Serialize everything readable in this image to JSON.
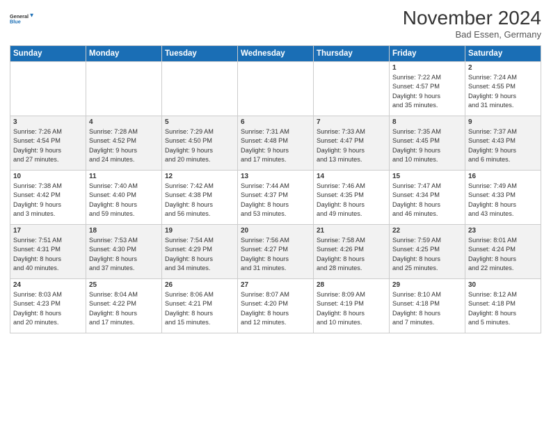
{
  "logo": {
    "line1": "General",
    "line2": "Blue"
  },
  "title": "November 2024",
  "location": "Bad Essen, Germany",
  "days_of_week": [
    "Sunday",
    "Monday",
    "Tuesday",
    "Wednesday",
    "Thursday",
    "Friday",
    "Saturday"
  ],
  "weeks": [
    [
      {
        "num": "",
        "info": ""
      },
      {
        "num": "",
        "info": ""
      },
      {
        "num": "",
        "info": ""
      },
      {
        "num": "",
        "info": ""
      },
      {
        "num": "",
        "info": ""
      },
      {
        "num": "1",
        "info": "Sunrise: 7:22 AM\nSunset: 4:57 PM\nDaylight: 9 hours\nand 35 minutes."
      },
      {
        "num": "2",
        "info": "Sunrise: 7:24 AM\nSunset: 4:55 PM\nDaylight: 9 hours\nand 31 minutes."
      }
    ],
    [
      {
        "num": "3",
        "info": "Sunrise: 7:26 AM\nSunset: 4:54 PM\nDaylight: 9 hours\nand 27 minutes."
      },
      {
        "num": "4",
        "info": "Sunrise: 7:28 AM\nSunset: 4:52 PM\nDaylight: 9 hours\nand 24 minutes."
      },
      {
        "num": "5",
        "info": "Sunrise: 7:29 AM\nSunset: 4:50 PM\nDaylight: 9 hours\nand 20 minutes."
      },
      {
        "num": "6",
        "info": "Sunrise: 7:31 AM\nSunset: 4:48 PM\nDaylight: 9 hours\nand 17 minutes."
      },
      {
        "num": "7",
        "info": "Sunrise: 7:33 AM\nSunset: 4:47 PM\nDaylight: 9 hours\nand 13 minutes."
      },
      {
        "num": "8",
        "info": "Sunrise: 7:35 AM\nSunset: 4:45 PM\nDaylight: 9 hours\nand 10 minutes."
      },
      {
        "num": "9",
        "info": "Sunrise: 7:37 AM\nSunset: 4:43 PM\nDaylight: 9 hours\nand 6 minutes."
      }
    ],
    [
      {
        "num": "10",
        "info": "Sunrise: 7:38 AM\nSunset: 4:42 PM\nDaylight: 9 hours\nand 3 minutes."
      },
      {
        "num": "11",
        "info": "Sunrise: 7:40 AM\nSunset: 4:40 PM\nDaylight: 8 hours\nand 59 minutes."
      },
      {
        "num": "12",
        "info": "Sunrise: 7:42 AM\nSunset: 4:38 PM\nDaylight: 8 hours\nand 56 minutes."
      },
      {
        "num": "13",
        "info": "Sunrise: 7:44 AM\nSunset: 4:37 PM\nDaylight: 8 hours\nand 53 minutes."
      },
      {
        "num": "14",
        "info": "Sunrise: 7:46 AM\nSunset: 4:35 PM\nDaylight: 8 hours\nand 49 minutes."
      },
      {
        "num": "15",
        "info": "Sunrise: 7:47 AM\nSunset: 4:34 PM\nDaylight: 8 hours\nand 46 minutes."
      },
      {
        "num": "16",
        "info": "Sunrise: 7:49 AM\nSunset: 4:33 PM\nDaylight: 8 hours\nand 43 minutes."
      }
    ],
    [
      {
        "num": "17",
        "info": "Sunrise: 7:51 AM\nSunset: 4:31 PM\nDaylight: 8 hours\nand 40 minutes."
      },
      {
        "num": "18",
        "info": "Sunrise: 7:53 AM\nSunset: 4:30 PM\nDaylight: 8 hours\nand 37 minutes."
      },
      {
        "num": "19",
        "info": "Sunrise: 7:54 AM\nSunset: 4:29 PM\nDaylight: 8 hours\nand 34 minutes."
      },
      {
        "num": "20",
        "info": "Sunrise: 7:56 AM\nSunset: 4:27 PM\nDaylight: 8 hours\nand 31 minutes."
      },
      {
        "num": "21",
        "info": "Sunrise: 7:58 AM\nSunset: 4:26 PM\nDaylight: 8 hours\nand 28 minutes."
      },
      {
        "num": "22",
        "info": "Sunrise: 7:59 AM\nSunset: 4:25 PM\nDaylight: 8 hours\nand 25 minutes."
      },
      {
        "num": "23",
        "info": "Sunrise: 8:01 AM\nSunset: 4:24 PM\nDaylight: 8 hours\nand 22 minutes."
      }
    ],
    [
      {
        "num": "24",
        "info": "Sunrise: 8:03 AM\nSunset: 4:23 PM\nDaylight: 8 hours\nand 20 minutes."
      },
      {
        "num": "25",
        "info": "Sunrise: 8:04 AM\nSunset: 4:22 PM\nDaylight: 8 hours\nand 17 minutes."
      },
      {
        "num": "26",
        "info": "Sunrise: 8:06 AM\nSunset: 4:21 PM\nDaylight: 8 hours\nand 15 minutes."
      },
      {
        "num": "27",
        "info": "Sunrise: 8:07 AM\nSunset: 4:20 PM\nDaylight: 8 hours\nand 12 minutes."
      },
      {
        "num": "28",
        "info": "Sunrise: 8:09 AM\nSunset: 4:19 PM\nDaylight: 8 hours\nand 10 minutes."
      },
      {
        "num": "29",
        "info": "Sunrise: 8:10 AM\nSunset: 4:18 PM\nDaylight: 8 hours\nand 7 minutes."
      },
      {
        "num": "30",
        "info": "Sunrise: 8:12 AM\nSunset: 4:18 PM\nDaylight: 8 hours\nand 5 minutes."
      }
    ]
  ]
}
